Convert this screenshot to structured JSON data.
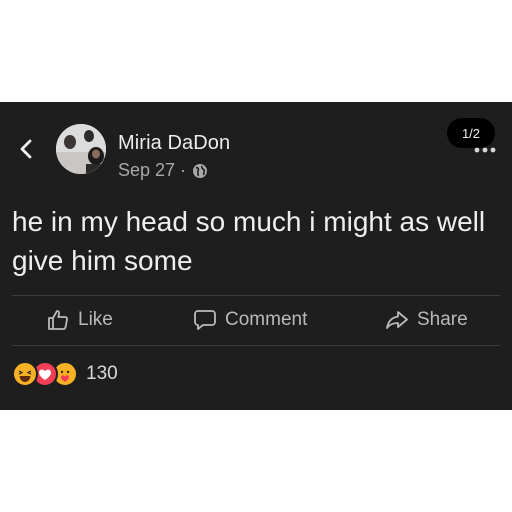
{
  "post": {
    "author": "Miria DaDon",
    "date": "Sep 27 ·",
    "privacy_icon": "globe-icon",
    "pager": "1/2",
    "text": "he in my head so much i might as well give him some"
  },
  "actions": {
    "like_label": "Like",
    "comment_label": "Comment",
    "share_label": "Share"
  },
  "reactions": {
    "icons": [
      "haha-icon",
      "love-icon",
      "care-icon"
    ],
    "count": "130"
  },
  "colors": {
    "background": "#1e1e1f",
    "text": "#e6e6e6",
    "muted": "#a8a8a8",
    "love": "#f33e58",
    "haha": "#f7b125"
  }
}
